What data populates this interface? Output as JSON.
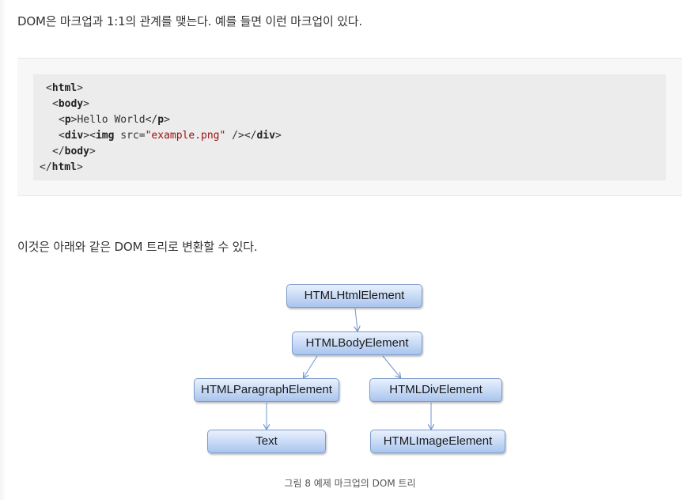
{
  "intro_text": "DOM은 마크업과 1:1의 관계를 맺는다. 예를 들면 이런 마크업이 있다.",
  "code": {
    "line1_tag": "html",
    "line2_tag": "body",
    "line3_tag": "p",
    "line3_text": "Hello World",
    "line4_div": "div",
    "line4_img": "img",
    "line4_attr": "src=",
    "line4_value": "\"example.png\"",
    "line5_tag": "body",
    "line6_tag": "html"
  },
  "outro_text": "이것은 아래와 같은 DOM 트리로 변환할 수 있다.",
  "diagram": {
    "nodes": {
      "html": "HTMLHtmlElement",
      "body": "HTMLBodyElement",
      "paragraph": "HTMLParagraphElement",
      "div": "HTMLDivElement",
      "text": "Text",
      "image": "HTMLImageElement"
    },
    "edges": [
      [
        "html",
        "body"
      ],
      [
        "body",
        "paragraph"
      ],
      [
        "body",
        "div"
      ],
      [
        "paragraph",
        "text"
      ],
      [
        "div",
        "image"
      ]
    ],
    "node_color": "#c6d9f6",
    "edge_color": "#6f95cf"
  },
  "caption": "그림 8 예제 마크업의 DOM 트리"
}
